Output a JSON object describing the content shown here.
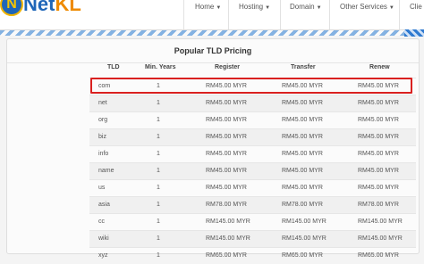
{
  "logo": {
    "mark": "N",
    "text_main": "Net",
    "text_accent": "KL"
  },
  "nav": [
    {
      "label": "Home"
    },
    {
      "label": "Hosting"
    },
    {
      "label": "Domain"
    },
    {
      "label": "Other Services"
    },
    {
      "label": "Clie"
    }
  ],
  "colors": {
    "accent": "#1f66b8",
    "highlight": "#d9201f",
    "brand_orange": "#ee8a00"
  },
  "panel": {
    "title": "Popular TLD Pricing",
    "columns": [
      "TLD",
      "Min. Years",
      "Register",
      "Transfer",
      "Renew"
    ],
    "rows": [
      {
        "tld": "com",
        "years": "1",
        "register": "RM45.00 MYR",
        "transfer": "RM45.00 MYR",
        "renew": "RM45.00 MYR"
      },
      {
        "tld": "net",
        "years": "1",
        "register": "RM45.00 MYR",
        "transfer": "RM45.00 MYR",
        "renew": "RM45.00 MYR"
      },
      {
        "tld": "org",
        "years": "1",
        "register": "RM45.00 MYR",
        "transfer": "RM45.00 MYR",
        "renew": "RM45.00 MYR"
      },
      {
        "tld": "biz",
        "years": "1",
        "register": "RM45.00 MYR",
        "transfer": "RM45.00 MYR",
        "renew": "RM45.00 MYR"
      },
      {
        "tld": "info",
        "years": "1",
        "register": "RM45.00 MYR",
        "transfer": "RM45.00 MYR",
        "renew": "RM45.00 MYR"
      },
      {
        "tld": "name",
        "years": "1",
        "register": "RM45.00 MYR",
        "transfer": "RM45.00 MYR",
        "renew": "RM45.00 MYR"
      },
      {
        "tld": "us",
        "years": "1",
        "register": "RM45.00 MYR",
        "transfer": "RM45.00 MYR",
        "renew": "RM45.00 MYR"
      },
      {
        "tld": "asia",
        "years": "1",
        "register": "RM78.00 MYR",
        "transfer": "RM78.00 MYR",
        "renew": "RM78.00 MYR"
      },
      {
        "tld": "cc",
        "years": "1",
        "register": "RM145.00 MYR",
        "transfer": "RM145.00 MYR",
        "renew": "RM145.00 MYR"
      },
      {
        "tld": "wiki",
        "years": "1",
        "register": "RM145.00 MYR",
        "transfer": "RM145.00 MYR",
        "renew": "RM145.00 MYR"
      },
      {
        "tld": "xyz",
        "years": "1",
        "register": "RM65.00 MYR",
        "transfer": "RM65.00 MYR",
        "renew": "RM65.00 MYR"
      }
    ]
  }
}
